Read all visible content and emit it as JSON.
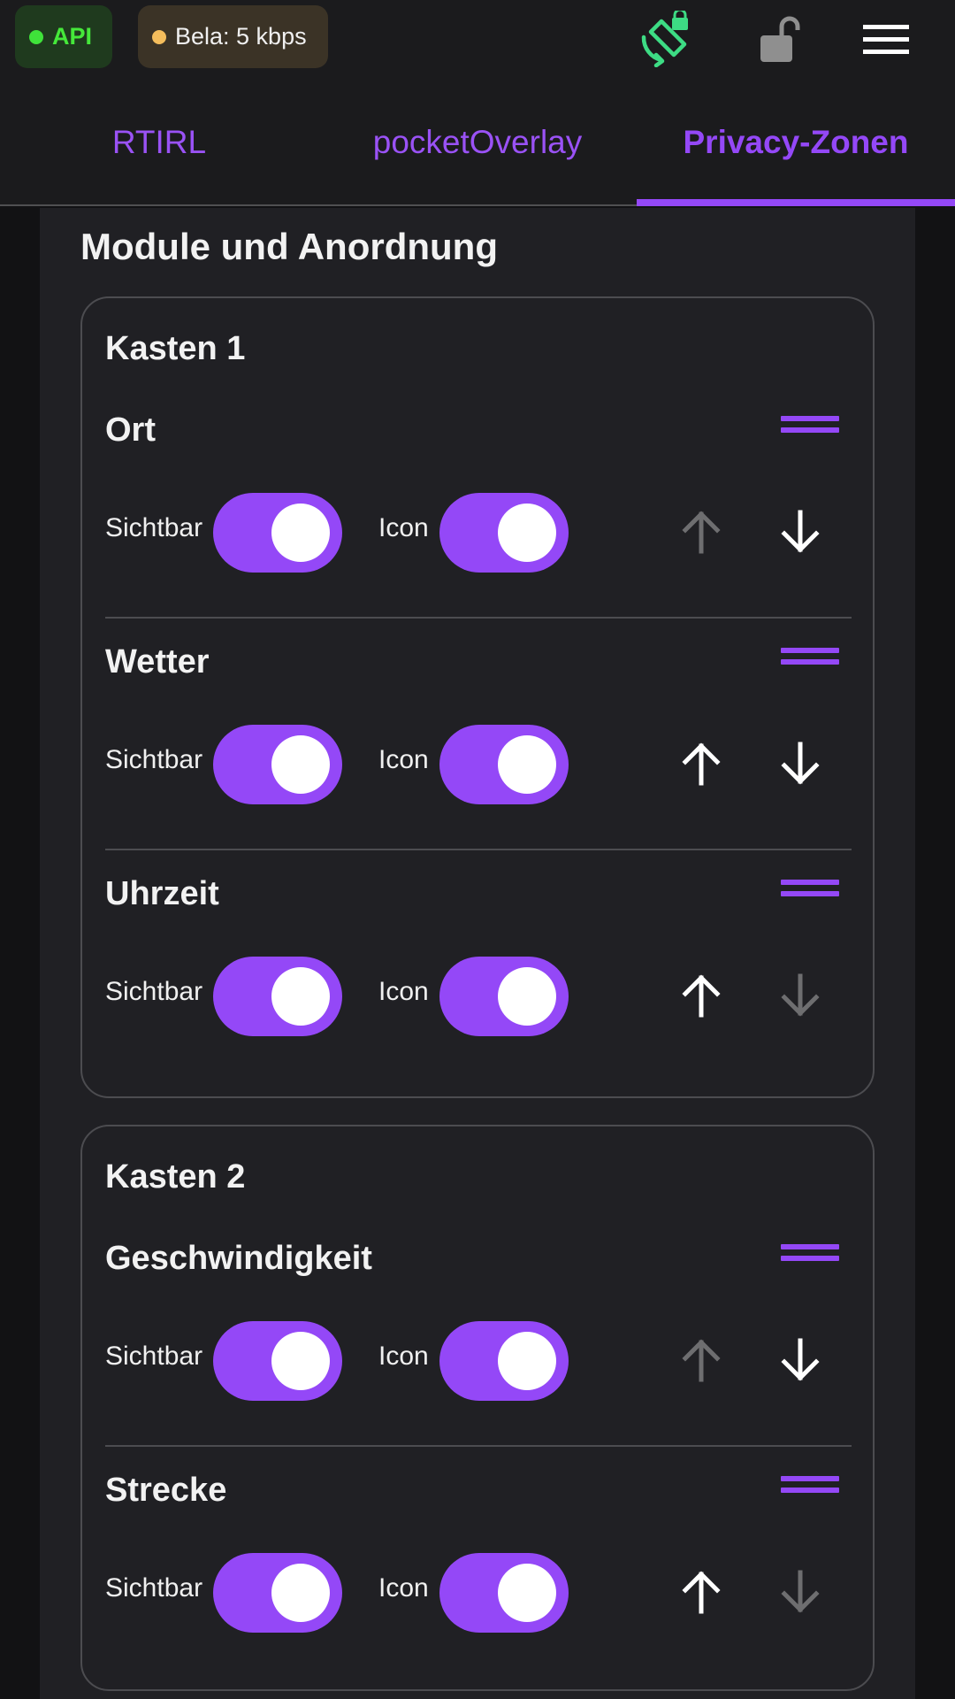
{
  "status": {
    "api_label": "API",
    "bela_label": "Bela: 5 kbps",
    "colors": {
      "api_dot": "#3fe23a",
      "bela_dot": "#f4bd5c"
    }
  },
  "header_icons": [
    "rotation-lock-icon",
    "unlock-icon",
    "menu-icon"
  ],
  "tabs": [
    {
      "label": "RTIRL",
      "active": false
    },
    {
      "label": "pocketOverlay",
      "active": false
    },
    {
      "label": "Privacy-Zonen",
      "active": true
    }
  ],
  "accent_color": "#9448f7",
  "section": {
    "title": "Module und Anordnung",
    "boxes": [
      {
        "title": "Kasten 1",
        "modules": [
          {
            "name": "Ort",
            "visible_label": "Sichtbar",
            "icon_label": "Icon",
            "visible_on": true,
            "icon_on": true,
            "up_enabled": false,
            "down_enabled": true
          },
          {
            "name": "Wetter",
            "visible_label": "Sichtbar",
            "icon_label": "Icon",
            "visible_on": true,
            "icon_on": true,
            "up_enabled": true,
            "down_enabled": true
          },
          {
            "name": "Uhrzeit",
            "visible_label": "Sichtbar",
            "icon_label": "Icon",
            "visible_on": true,
            "icon_on": true,
            "up_enabled": true,
            "down_enabled": false
          }
        ]
      },
      {
        "title": "Kasten 2",
        "modules": [
          {
            "name": "Geschwindigkeit",
            "visible_label": "Sichtbar",
            "icon_label": "Icon",
            "visible_on": true,
            "icon_on": true,
            "up_enabled": false,
            "down_enabled": true
          },
          {
            "name": "Strecke",
            "visible_label": "Sichtbar",
            "icon_label": "Icon",
            "visible_on": true,
            "icon_on": true,
            "up_enabled": true,
            "down_enabled": false
          }
        ]
      }
    ]
  }
}
